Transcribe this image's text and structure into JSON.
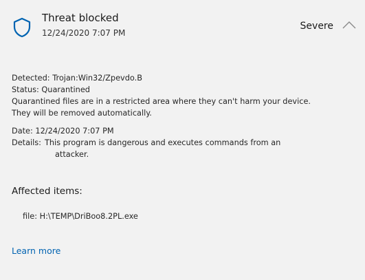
{
  "threat": {
    "title": "Threat blocked",
    "timestamp": "12/24/2020 7:07 PM",
    "severity": "Severe",
    "icon": "shield-icon",
    "accent_color": "#0063b1"
  },
  "details": {
    "detected_label": "Detected:",
    "detected_value": "Trojan:Win32/Zpevdo.B",
    "status_label": "Status:",
    "status_value": "Quarantined",
    "quarantine_note_line1": "Quarantined files are in a restricted area where they can't harm your device.",
    "quarantine_note_line2": "They will be removed automatically.",
    "date_label": "Date:",
    "date_value": "12/24/2020 7:07 PM",
    "details_label": "Details:",
    "details_value_line1": "This program is dangerous and executes commands from an",
    "details_value_line2": "attacker."
  },
  "affected": {
    "heading": "Affected items:",
    "items": [
      {
        "label": "file:",
        "path": "H:\\TEMP\\DriBoo8.2PL.exe"
      }
    ]
  },
  "links": {
    "learn_more": "Learn more"
  }
}
